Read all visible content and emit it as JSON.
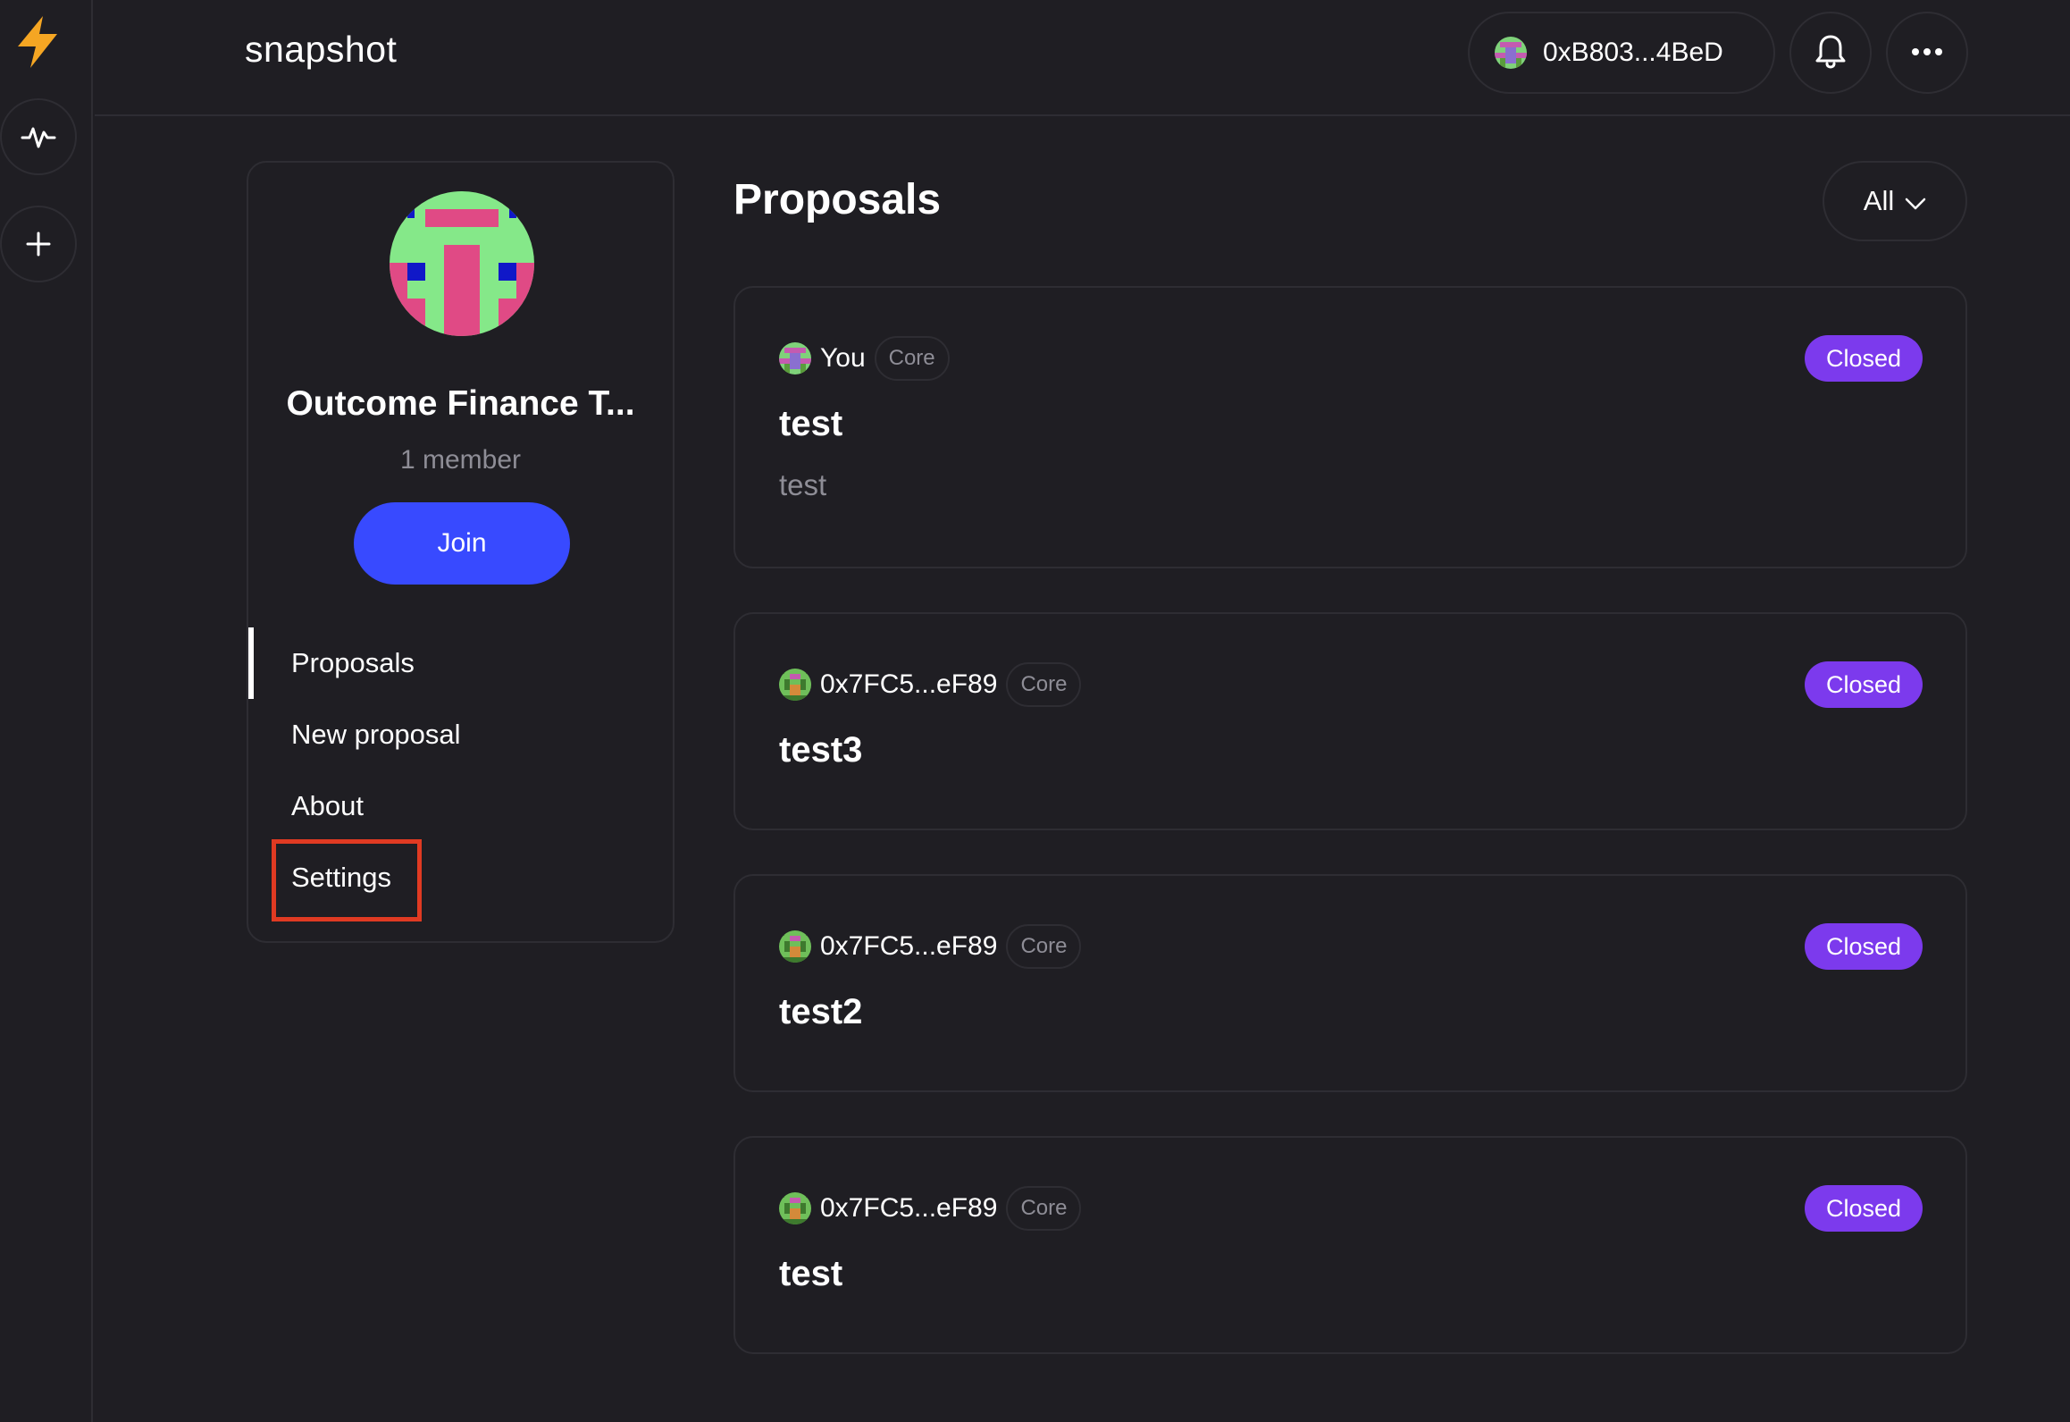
{
  "app": {
    "brand": "snapshot"
  },
  "rail": {
    "logo_icon": "lightning-bolt-icon",
    "items": [
      {
        "icon": "activity-icon"
      },
      {
        "icon": "plus-icon"
      }
    ]
  },
  "header": {
    "wallet_address": "0xB803...4BeD",
    "bell_icon": "bell-icon",
    "more_icon": "more-horizontal-icon"
  },
  "space": {
    "name": "Outcome Finance T...",
    "members": "1 member",
    "join_label": "Join"
  },
  "nav": {
    "items": [
      {
        "label": "Proposals",
        "active": true
      },
      {
        "label": "New proposal",
        "active": false
      },
      {
        "label": "About",
        "active": false
      },
      {
        "label": "Settings",
        "active": false
      }
    ]
  },
  "main": {
    "title": "Proposals",
    "filter_label": "All"
  },
  "proposals": [
    {
      "author": "You",
      "badge": "Core",
      "status": "Closed",
      "title": "test",
      "body": "test"
    },
    {
      "author": "0x7FC5...eF89",
      "badge": "Core",
      "status": "Closed",
      "title": "test3",
      "body": ""
    },
    {
      "author": "0x7FC5...eF89",
      "badge": "Core",
      "status": "Closed",
      "title": "test2",
      "body": ""
    },
    {
      "author": "0x7FC5...eF89",
      "badge": "Core",
      "status": "Closed",
      "title": "test",
      "body": ""
    }
  ],
  "colors": {
    "background": "#1f1e23",
    "border": "#2e2d33",
    "primary": "#384aff",
    "closed_badge": "#7c3aed",
    "highlight": "#e03a22",
    "muted_text": "#8e8d96",
    "logo": "#f5a623"
  }
}
